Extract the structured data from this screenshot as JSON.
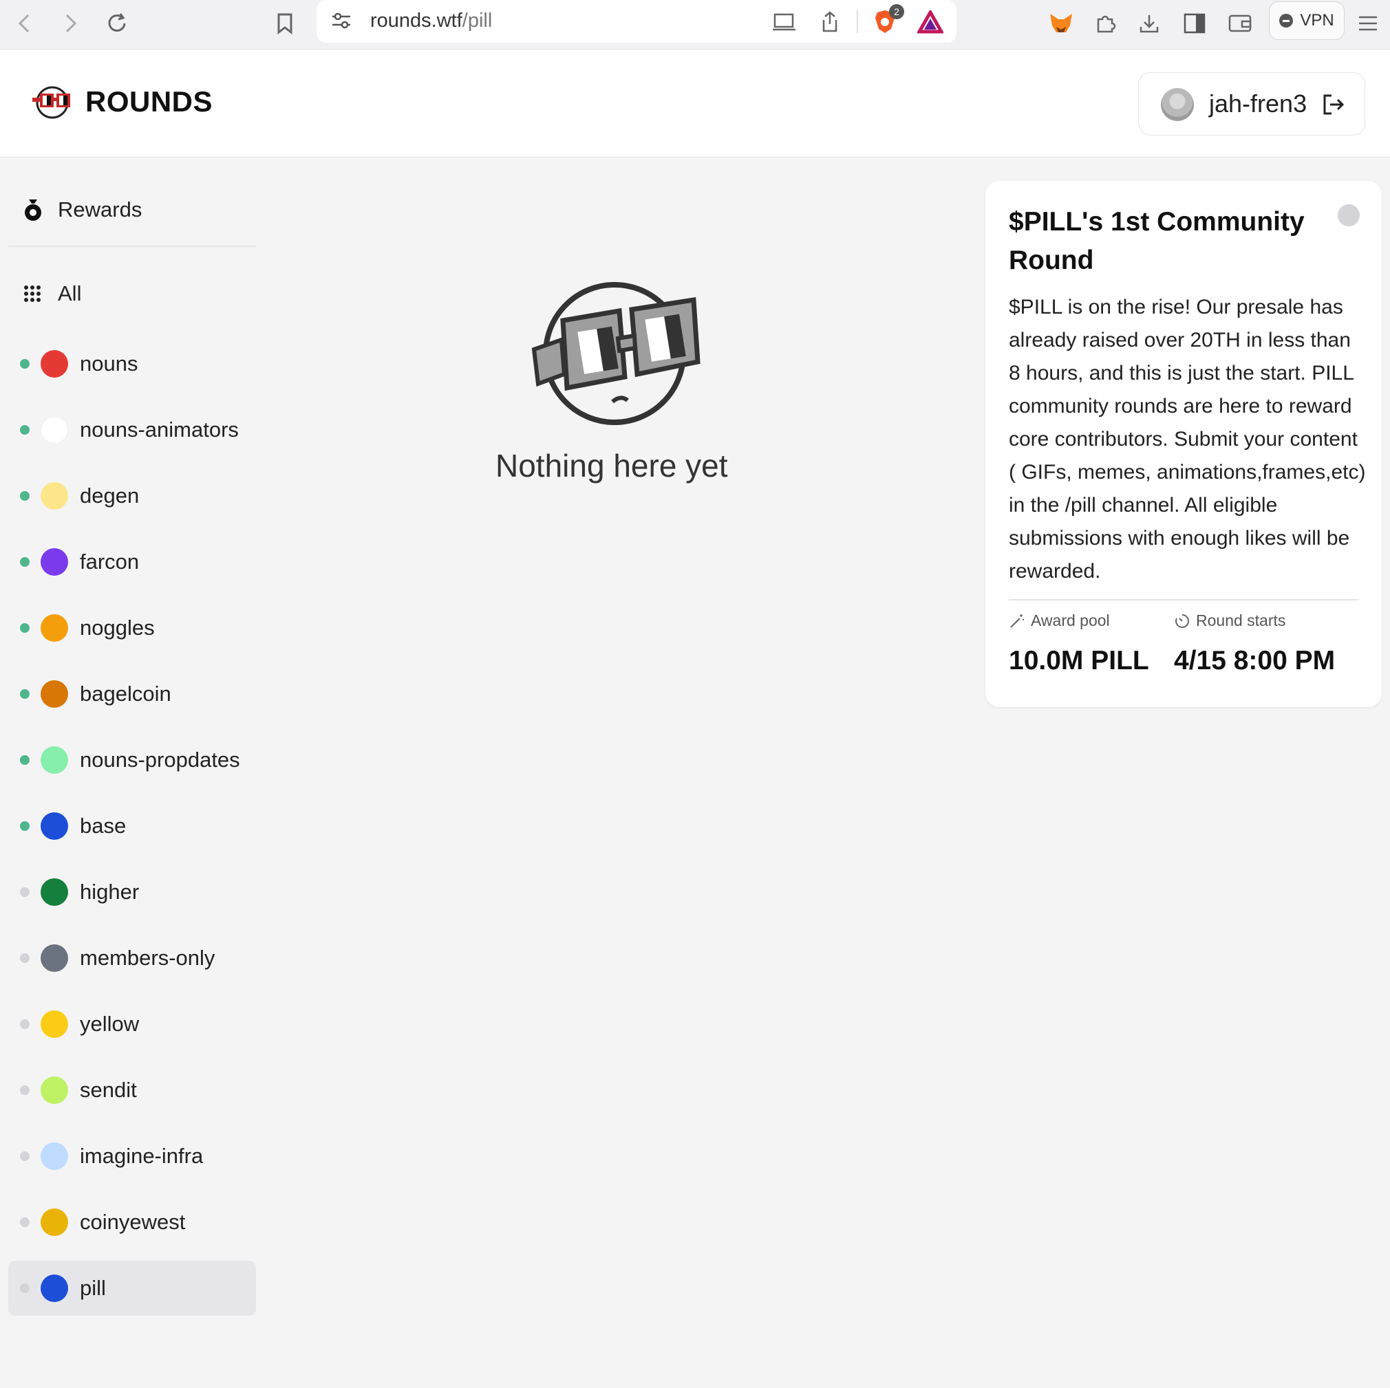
{
  "browser": {
    "url_domain": "rounds.wtf",
    "url_path": "/pill",
    "shield_badge": "2",
    "vpn_label": "VPN"
  },
  "header": {
    "brand": "ROUNDS",
    "username": "jah-fren3"
  },
  "sidebar": {
    "rewards_label": "Rewards",
    "all_label": "All",
    "items": [
      {
        "label": "nouns",
        "active": true,
        "icon": "noggles-red",
        "color": "#e53935"
      },
      {
        "label": "nouns-animators",
        "active": true,
        "icon": "nouns-animators-logo",
        "color": "#ffffff"
      },
      {
        "label": "degen",
        "active": true,
        "icon": "degen-hat-icon",
        "color": "#fde68a"
      },
      {
        "label": "farcon",
        "active": true,
        "icon": "farcaster-arch-icon",
        "color": "#7c3aed"
      },
      {
        "label": "noggles",
        "active": true,
        "icon": "noggles-coin-icon",
        "color": "#f59e0b"
      },
      {
        "label": "bagelcoin",
        "active": true,
        "icon": "bagel-icon",
        "color": "#d97706"
      },
      {
        "label": "nouns-propdates",
        "active": true,
        "icon": "propdates-icon",
        "color": "#86efac"
      },
      {
        "label": "base",
        "active": true,
        "icon": "base-circle-icon",
        "color": "#1d4ed8"
      },
      {
        "label": "higher",
        "active": false,
        "icon": "arrow-up-icon",
        "color": "#15803d"
      },
      {
        "label": "members-only",
        "active": false,
        "icon": "members-avatar-icon",
        "color": "#6b7280"
      },
      {
        "label": "yellow",
        "active": false,
        "icon": "yellow-circle-icon",
        "color": "#facc15"
      },
      {
        "label": "sendit",
        "active": false,
        "icon": "sendit-arrow-icon",
        "color": "#bef264"
      },
      {
        "label": "imagine-infra",
        "active": false,
        "icon": "imagine-infra-icon",
        "color": "#bfdbfe"
      },
      {
        "label": "coinyewest",
        "active": false,
        "icon": "coinyewest-icon",
        "color": "#eab308"
      },
      {
        "label": "pill",
        "active": false,
        "icon": "pill-icon",
        "color": "#1d4ed8",
        "selected": true
      }
    ]
  },
  "empty_state": {
    "message": "Nothing here yet"
  },
  "round_card": {
    "title": "$PILL's 1st Community Round",
    "description": "$PILL is on the rise! Our presale has already raised over 20TH in less than 8 hours, and this is just the start. PILL community rounds are here to reward core contributors. Submit your content ( GIFs, memes, animations,frames,etc) in the /pill channel. All eligible submissions with enough likes will be rewarded.",
    "award_pool_label": "Award pool",
    "award_pool_value": "10.0M PILL",
    "round_starts_label": "Round starts",
    "round_starts_value": "4/15 8:00 PM"
  },
  "colors": {
    "active_status": "#4fb58c",
    "inactive_status": "#d4d4d8",
    "accent": "#111111"
  }
}
